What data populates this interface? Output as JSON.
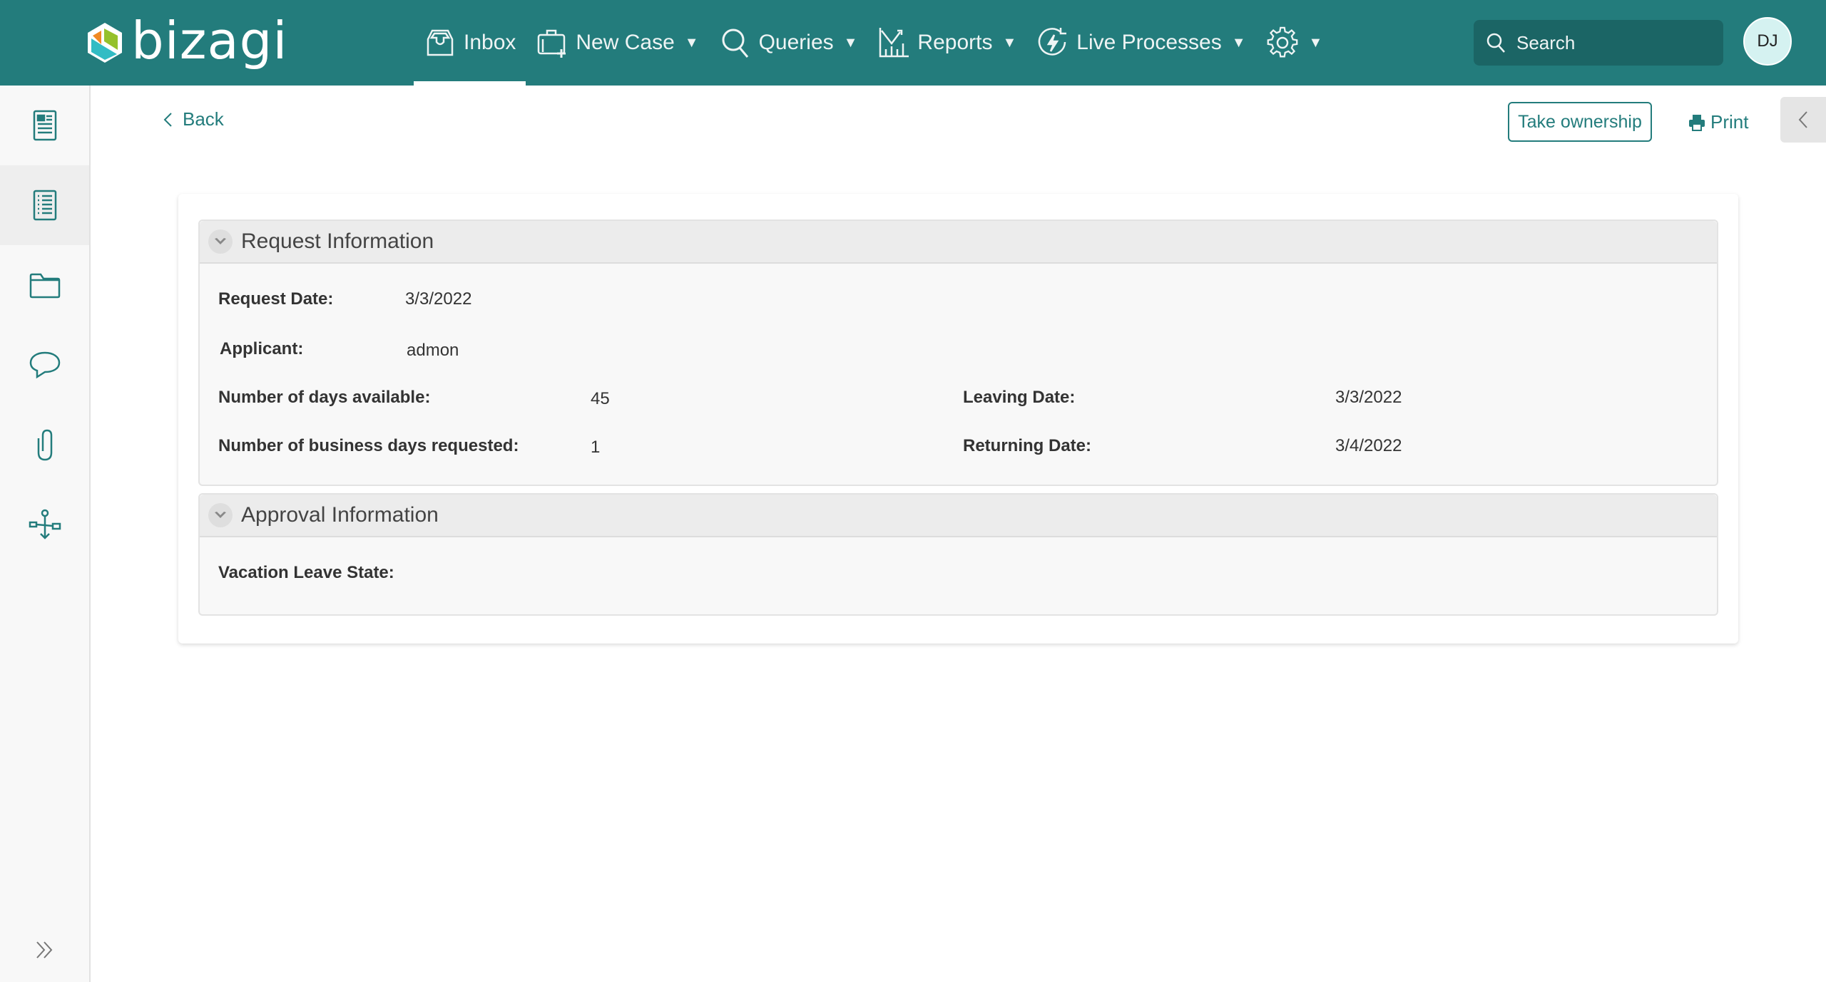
{
  "header": {
    "logo_text": "bizagi",
    "nav": [
      {
        "label": "Inbox",
        "icon": "inbox-icon",
        "active": true,
        "has_caret": false
      },
      {
        "label": "New Case",
        "icon": "new-case-icon",
        "has_caret": true
      },
      {
        "label": "Queries",
        "icon": "search-icon",
        "has_caret": true
      },
      {
        "label": "Reports",
        "icon": "reports-chart-icon",
        "has_caret": true
      },
      {
        "label": "Live Processes",
        "icon": "live-processes-icon",
        "has_caret": true
      },
      {
        "label": "",
        "icon": "gear-icon",
        "has_caret": true
      }
    ],
    "caret": "▼",
    "search_placeholder": "Search",
    "avatar_initials": "DJ",
    "colors": {
      "brand": "#237c7c",
      "search_bg": "#1b6565",
      "avatar_bg": "#d5f2f1"
    }
  },
  "sidebar": {
    "items": [
      {
        "icon": "form-icon",
        "active": false
      },
      {
        "icon": "list-document-icon",
        "active": true
      },
      {
        "icon": "folder-icon",
        "active": false
      },
      {
        "icon": "comment-icon",
        "active": false
      },
      {
        "icon": "paperclip-icon",
        "active": false
      },
      {
        "icon": "process-map-icon",
        "active": false
      }
    ],
    "expand_icon": "double-chevron-right-icon"
  },
  "toolbar": {
    "back_label": "Back",
    "take_ownership_label": "Take ownership",
    "print_label": "Print"
  },
  "form": {
    "sections": [
      {
        "title": "Request Information",
        "fields": [
          {
            "label": "Request Date:",
            "value": "3/3/2022"
          },
          {
            "label": "Applicant:",
            "value": "admon"
          },
          {
            "label": "Number of days available:",
            "value": "45"
          },
          {
            "label": "Number of business days requested:",
            "value": "1"
          },
          {
            "label": "Leaving Date:",
            "value": "3/3/2022"
          },
          {
            "label": "Returning Date:",
            "value": "3/4/2022"
          }
        ]
      },
      {
        "title": "Approval Information",
        "fields": [
          {
            "label": "Vacation Leave State:",
            "value": ""
          }
        ]
      }
    ]
  }
}
